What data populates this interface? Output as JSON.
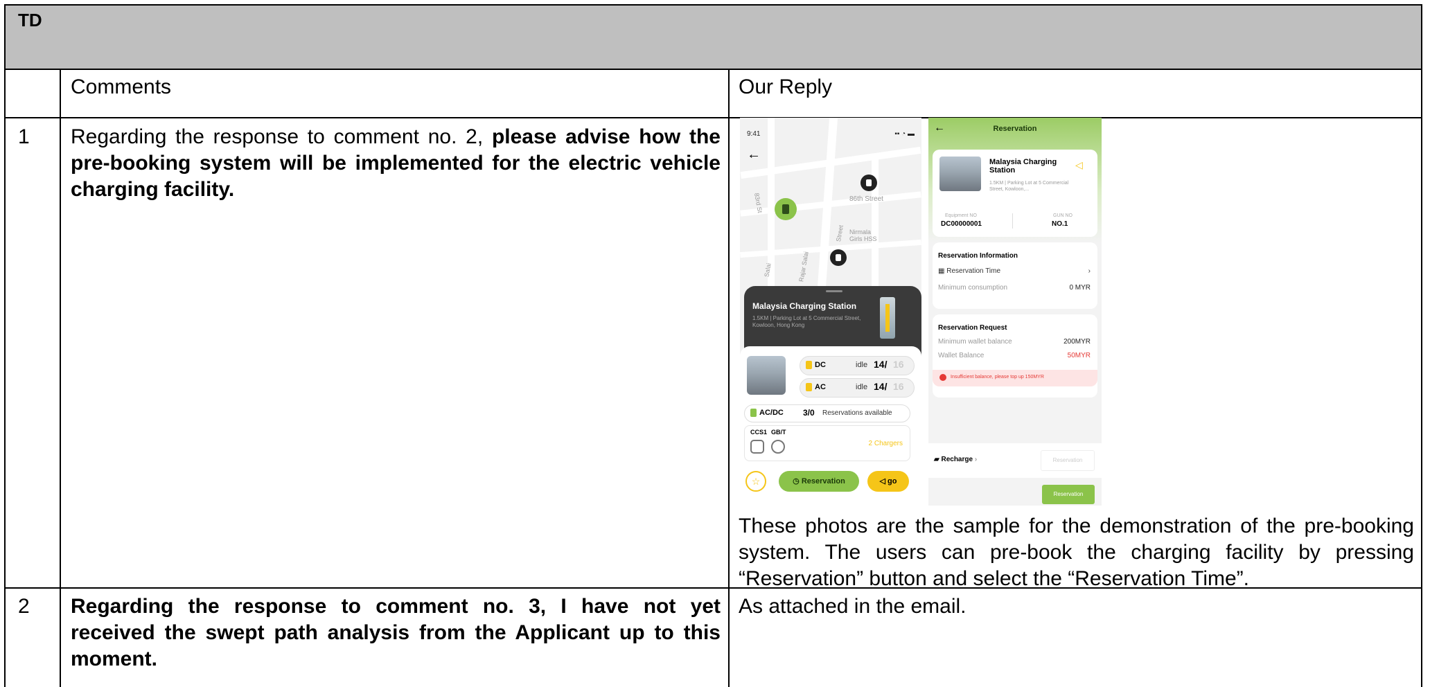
{
  "header": {
    "title": "TD"
  },
  "columns": {
    "comments": "Comments",
    "reply": "Our Reply"
  },
  "rows": [
    {
      "no": "1",
      "comment_plain": "Regarding the response to comment no. 2, ",
      "comment_bold": "please advise how the pre-booking system will be implemented for the electric vehicle charging facility.",
      "reply": "These photos are the sample for the demonstration of the pre-booking system. The users can pre-book the charging facility by pressing “Reservation” button and select the “Reservation Time”."
    },
    {
      "no": "2",
      "comment_bold": "Regarding the response to comment no. 3, I have not yet received the swept path analysis from the Applicant up to this moment.",
      "reply": "As attached in the email."
    }
  ],
  "phone_map": {
    "time": "9:41",
    "street_86": "86th Street",
    "nirmala": "Nirmala Girls HSS",
    "station_name": "Malaysia Charging Station",
    "address": "1.5KM | Parking Lot at 5 Commercial Street, Kowloon, Hong Kong",
    "dc_label": "DC",
    "ac_label": "AC",
    "idle_label": "idle",
    "dc_count": "14/",
    "dc_total": "16",
    "ac_count": "14/",
    "ac_total": "16",
    "acdc_label": "AC/DC",
    "acdc_count": "3/0",
    "reservations_available": "Reservations available",
    "ccs1": "CCS1",
    "gbt": "GB/T",
    "chargers": "2 Chargers",
    "reservation_btn": "Reservation",
    "go_btn": "go",
    "map_labels": [
      "83rd St",
      "Street",
      "Rajar Salai",
      "Salai"
    ]
  },
  "phone_reservation": {
    "title": "Reservation",
    "station_name": "Malaysia Charging Station",
    "address": "1.5KM | Parking Lot at 5 Commercial Street, Kowloon,...",
    "equipment_label": "Equipment NO",
    "equipment_value": "DC00000001",
    "gun_label": "GUN NO",
    "gun_value": "NO.1",
    "info_title": "Reservation Information",
    "reservation_time": "Reservation Time",
    "min_consumption": "Minimum consumption",
    "min_consumption_value": "0 MYR",
    "request_title": "Reservation Request",
    "min_wallet": "Minimum wallet balance",
    "min_wallet_value": "200MYR",
    "wallet_balance": "Wallet Balance",
    "wallet_balance_value": "50MYR",
    "warning": "Insufficient balance, please top up 150MYR",
    "recharge": "Recharge",
    "reservation_disabled": "Reservation",
    "reservation_btn": "Reservation"
  },
  "colors": {
    "header_bg": "#bfbfbf",
    "green": "#8bc34a",
    "yellow": "#f5c518",
    "red": "#e53935"
  }
}
